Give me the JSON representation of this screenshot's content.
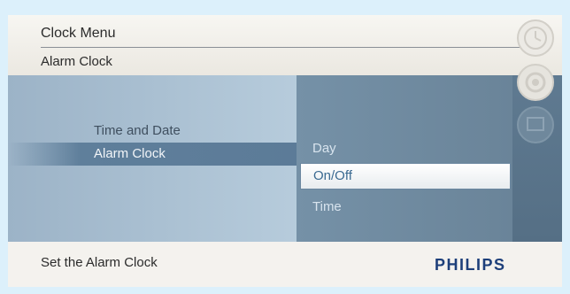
{
  "header": {
    "title": "Clock Menu",
    "subtitle": "Alarm Clock"
  },
  "menu": {
    "items": [
      {
        "label": "Time and Date",
        "selected": false
      },
      {
        "label": "Alarm Clock",
        "selected": true
      }
    ]
  },
  "submenu": {
    "options": [
      {
        "label": "Day",
        "selected": false
      },
      {
        "label": "On/Off",
        "selected": true
      },
      {
        "label": "Time",
        "selected": false
      }
    ]
  },
  "footer": {
    "hint": "Set the Alarm Clock",
    "brand": "PHILIPS"
  },
  "colors": {
    "background": "#dcf0fb",
    "panel": "#f3f1ec",
    "selection": "#5c7b98",
    "brand": "#1d3f7a"
  },
  "icons": [
    "clock-icon",
    "settings-icon",
    "slideshow-icon"
  ]
}
